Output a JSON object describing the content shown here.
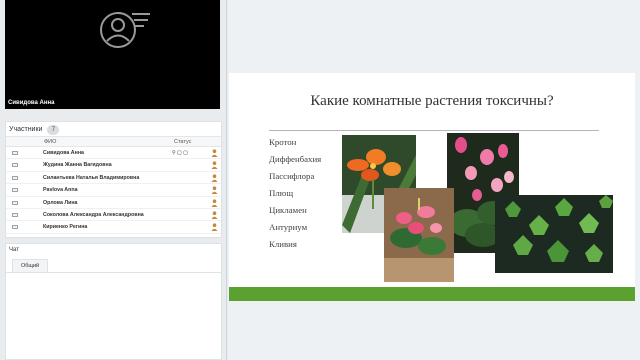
{
  "video": {
    "participant_name": "Сивидова Анна",
    "icon": "user-chat-icon"
  },
  "participants": {
    "header": "Участники",
    "count": "7",
    "col_name": "ФИО",
    "col_status": "Статус",
    "rows": [
      {
        "name": "Сивидова Анна",
        "status": "⚲ ▢ ▢"
      },
      {
        "name": "Жудина Жанна Вагидовна"
      },
      {
        "name": "Силантьева Наталья Владимировна"
      },
      {
        "name": "Pavlova Anna"
      },
      {
        "name": "Орлова Лина"
      },
      {
        "name": "Соколова Александра Александровна"
      },
      {
        "name": "Кириенко Регина"
      }
    ]
  },
  "chat": {
    "header": "Чат",
    "tab": "Общий"
  },
  "slide": {
    "title": "Какие комнатные растения токсичны?",
    "items": [
      "Кротон",
      "Диффенбахия",
      "Пассифлора",
      "Плющ",
      "Цикламен",
      "Антуриум",
      "Кливия"
    ],
    "accent_color": "#5aa12f"
  }
}
